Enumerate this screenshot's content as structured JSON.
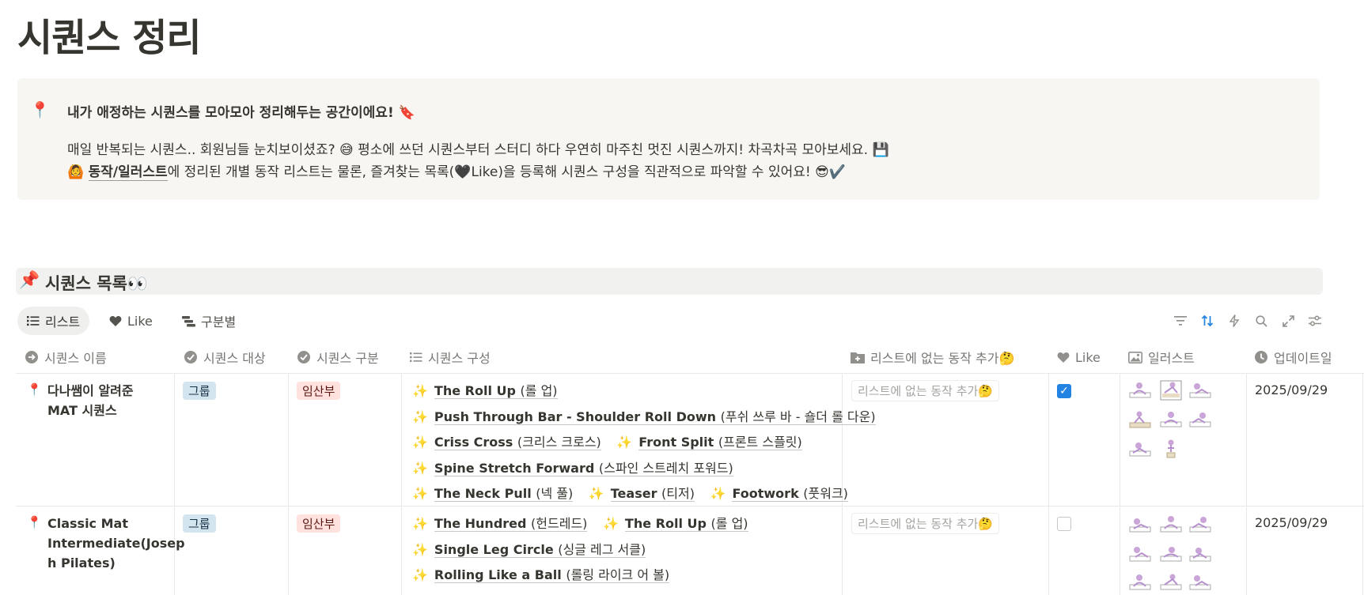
{
  "page": {
    "title": "시퀀스 정리"
  },
  "callout": {
    "icon": "📍",
    "lead": "내가 애정하는 시퀀스를 모아모아 정리해두는 공간이에요! 🔖",
    "line1": "매일 반복되는 시퀀스.. 회원님들 눈치보이셨죠? 😅 평소에 쓰던 시퀀스부터 스터디 하다 우연히 마주친 멋진 시퀀스까지! 차곡차곡 모아보세요. 💾",
    "line2_emoji": "🙆",
    "line2_link": "동작/일러스트",
    "line2_rest": "에 정리된 개별 동작 리스트는 물론, 즐겨찾는 목록(🖤Like)을 등록해 시퀀스 구성을 직관적으로 파악할 수 있어요! 😎✔️"
  },
  "section": {
    "icon": "📌",
    "title": "시퀀스 목록👀"
  },
  "views": [
    {
      "label": "리스트",
      "icon": "list-icon",
      "active": true
    },
    {
      "label": "Like",
      "icon": "heart-icon",
      "active": false
    },
    {
      "label": "구분별",
      "icon": "board-icon",
      "active": false
    }
  ],
  "toolbar_icons": [
    "filter-icon",
    "sort-icon",
    "automation-icon",
    "search-icon",
    "expand-icon",
    "settings-icon"
  ],
  "columns": [
    {
      "label": "시퀀스 이름",
      "icon": "title-icon"
    },
    {
      "label": "시퀀스 대상",
      "icon": "select-icon"
    },
    {
      "label": "시퀀스 구분",
      "icon": "select-icon"
    },
    {
      "label": "시퀀스 구성",
      "icon": "list-icon"
    },
    {
      "label": "리스트에 없는 동작 추가🤔",
      "icon": "folder-add-icon"
    },
    {
      "label": "Like",
      "icon": "heart-icon"
    },
    {
      "label": "일러스트",
      "icon": "image-icon"
    },
    {
      "label": "업데이트일",
      "icon": "clock-icon"
    }
  ],
  "rows": [
    {
      "icon": "📍",
      "name_lines": [
        "다나쌤이 알려준",
        "MAT 시퀀스"
      ],
      "target": "그룹",
      "category": "임산부",
      "sequence_lines": [
        [
          {
            "en": "The Roll Up",
            "kr": "(롤 업)"
          }
        ],
        [
          {
            "en": "Push Through Bar - Shoulder Roll Down",
            "kr": "(푸쉬 쓰루 바 - 숄더 롤 다운)"
          }
        ],
        [
          {
            "en": "Criss Cross",
            "kr": "(크리스 크로스)"
          },
          {
            "en": "Front Split",
            "kr": "(프론트 스플릿)"
          }
        ],
        [
          {
            "en": "Spine Stretch Forward",
            "kr": "(스파인 스트레치 포워드)"
          }
        ],
        [
          {
            "en": "The Neck Pull",
            "kr": "(넥 풀)"
          },
          {
            "en": "Teaser",
            "kr": "(티저)"
          },
          {
            "en": "Footwork",
            "kr": "(풋워크)"
          }
        ]
      ],
      "extra_placeholder": "리스트에 없는 동작 추가🤔",
      "like": true,
      "illustration_count": 8,
      "updated": "2025/09/29"
    },
    {
      "icon": "📍",
      "name_lines": [
        "Classic Mat",
        "Intermediate(Josep",
        "h Pilates)"
      ],
      "target": "그룹",
      "category": "임산부",
      "sequence_lines": [
        [
          {
            "en": "The Hundred",
            "kr": "(헌드레드)"
          },
          {
            "en": "The Roll Up",
            "kr": "(롤 업)"
          }
        ],
        [
          {
            "en": "Single Leg Circle",
            "kr": "(싱글 레그 서클)"
          }
        ],
        [
          {
            "en": "Rolling Like a Ball",
            "kr": "(롤링 라이크 어 볼)"
          }
        ]
      ],
      "extra_placeholder": "리스트에 없는 동작 추가🤔",
      "like": false,
      "illustration_count": 9,
      "updated": "2025/09/29"
    }
  ],
  "colors": {
    "accent": "#2383e2",
    "tag_blue_bg": "#d3e5ef",
    "tag_red_bg": "#ffe2dd",
    "callout_bg": "#f7f6f3",
    "sparkle": "#e9a23b"
  }
}
